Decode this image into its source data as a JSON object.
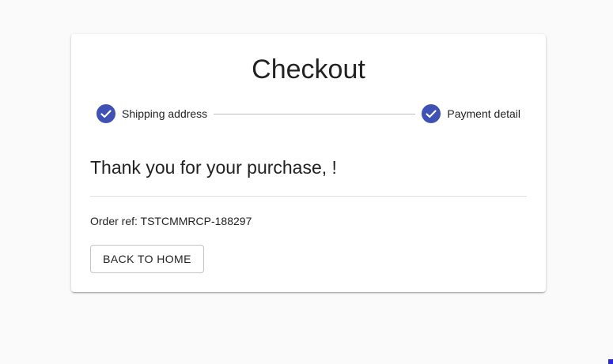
{
  "checkout": {
    "title": "Checkout",
    "steps": [
      {
        "label": "Shipping address",
        "status": "completed",
        "icon": "check-circle-icon"
      },
      {
        "label": "Payment detail",
        "status": "completed",
        "icon": "check-circle-icon"
      }
    ],
    "thanks_message": "Thank you for your purchase, !",
    "order_ref": "Order ref: TSTCMMRCP-188297",
    "back_button_label": "BACK TO HOME"
  },
  "colors": {
    "accent": "#3f51b5",
    "background": "#fafafa",
    "card": "#ffffff",
    "connector": "#bdbdbd"
  }
}
